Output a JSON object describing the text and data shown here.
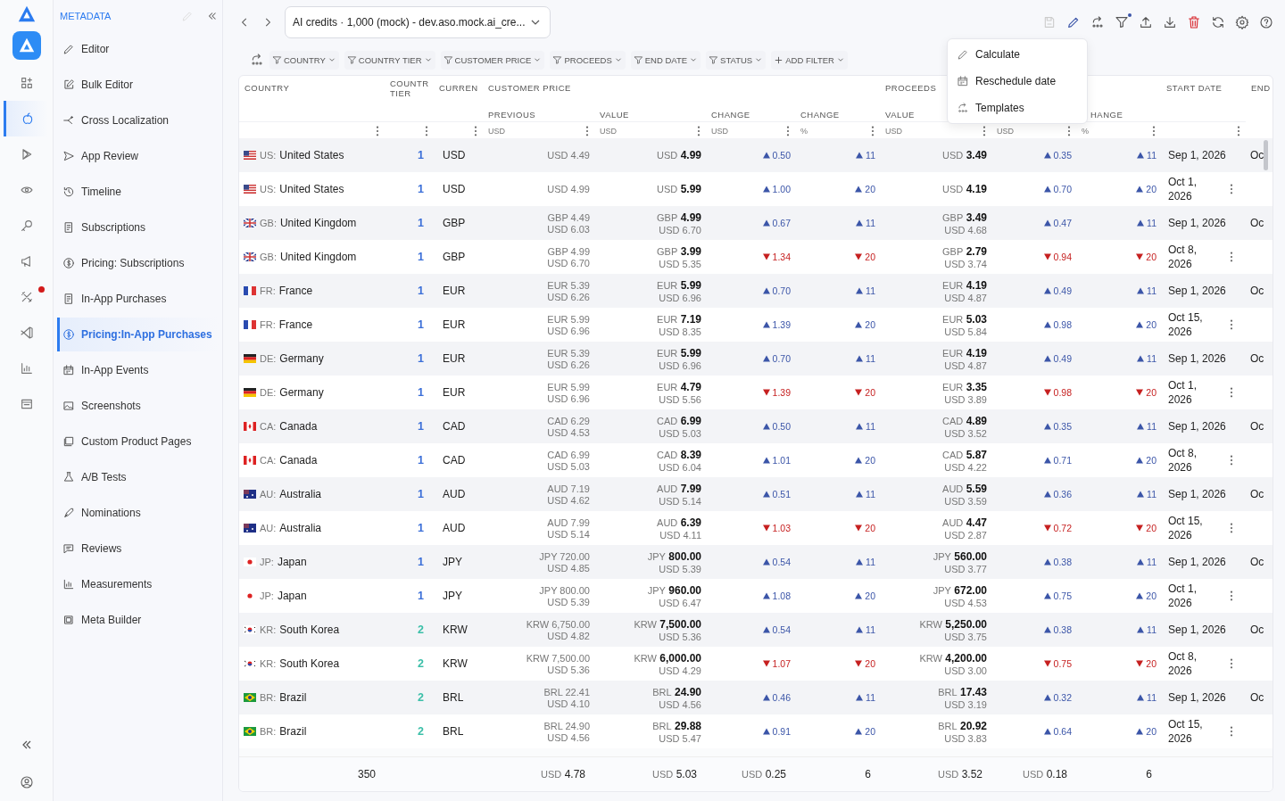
{
  "sidebar": {
    "title": "METADATA",
    "items": [
      {
        "label": "Editor",
        "selected": false
      },
      {
        "label": "Bulk Editor",
        "selected": false
      },
      {
        "label": "Cross Localization",
        "selected": false
      },
      {
        "label": "App Review",
        "selected": false
      },
      {
        "label": "Timeline",
        "selected": false
      },
      {
        "label": "Subscriptions",
        "selected": false
      },
      {
        "label": "Pricing: Subscriptions",
        "selected": false
      },
      {
        "label": "In-App Purchases",
        "selected": false
      },
      {
        "label": "Pricing:In-App Purchases",
        "selected": true
      },
      {
        "label": "In-App Events",
        "selected": false
      },
      {
        "label": "Screenshots",
        "selected": false
      },
      {
        "label": "Custom Product Pages",
        "selected": false
      },
      {
        "label": "A/B Tests",
        "selected": false
      },
      {
        "label": "Nominations",
        "selected": false
      },
      {
        "label": "Reviews",
        "selected": false
      },
      {
        "label": "Measurements",
        "selected": false
      },
      {
        "label": "Meta Builder",
        "selected": false
      }
    ]
  },
  "rail": [
    {
      "selected": false
    },
    {
      "selected": true
    },
    {
      "selected": false
    },
    {
      "selected": false
    },
    {
      "selected": false
    },
    {
      "selected": false
    },
    {
      "selected": false
    },
    {
      "selected": false
    },
    {
      "selected": false
    },
    {
      "selected": false
    }
  ],
  "product_select": {
    "value": "AI credits · 1,000 (mock) - dev.aso.mock.ai_cre..."
  },
  "filters": [
    "COUNTRY",
    "COUNTRY TIER",
    "CUSTOMER PRICE",
    "PROCEEDS",
    "END DATE",
    "STATUS"
  ],
  "add_filter": "ADD FILTER",
  "menu": [
    "Calculate",
    "Reschedule date",
    "Templates"
  ],
  "header": {
    "country": "COUNTRY",
    "tier": "COUNTR TIER",
    "currency": "CURREN",
    "customer_price": {
      "title": "CUSTOMER PRICE",
      "columns": [
        {
          "label": "PREVIOUS",
          "unit": "USD"
        },
        {
          "label": "VALUE",
          "unit": "USD"
        },
        {
          "label": "CHANGE",
          "unit": "USD"
        },
        {
          "label": "CHANGE",
          "unit": "%"
        }
      ]
    },
    "proceeds": {
      "title": "PROCEEDS",
      "columns": [
        {
          "label": "VALUE",
          "unit": "USD"
        },
        {
          "unit": "USD"
        },
        {
          "label": "HANGE",
          "unit": "%"
        }
      ]
    },
    "start_date": "START DATE",
    "end": "END"
  },
  "rows": [
    {
      "kind": "us",
      "code": "US:",
      "country": "United States",
      "tier": "1",
      "color": "#3b6fd8",
      "currency": "USD",
      "previous": {
        "local": "USD 4.49"
      },
      "value": {
        "currency": "USD",
        "amount": "4.99"
      },
      "increase": true,
      "change": "0.50",
      "change_pct": "11",
      "proceeds": {
        "currency": "USD",
        "amount": "3.49"
      },
      "proceeds_change": "0.35",
      "proceeds_change_pct": "11",
      "start_date": "Sep 1, 2026",
      "end_date": "Oc"
    },
    {
      "kind": "us",
      "code": "US:",
      "country": "United States",
      "tier": "1",
      "color": "#3b6fd8",
      "currency": "USD",
      "previous": {
        "local": "USD 4.99"
      },
      "value": {
        "currency": "USD",
        "amount": "5.99"
      },
      "increase": true,
      "change": "1.00",
      "change_pct": "20",
      "proceeds": {
        "currency": "USD",
        "amount": "4.19"
      },
      "proceeds_change": "0.70",
      "proceeds_change_pct": "20",
      "start_date": "Oct 1, 2026"
    },
    {
      "kind": "gb",
      "code": "GB:",
      "country": "United Kingdom",
      "tier": "1",
      "color": "#3b6fd8",
      "currency": "GBP",
      "previous": {
        "local": "GBP 4.49",
        "usd": "USD 6.03"
      },
      "value": {
        "currency": "GBP",
        "amount": "4.99",
        "usd": "USD 6.70"
      },
      "increase": true,
      "change": "0.67",
      "change_pct": "11",
      "proceeds": {
        "currency": "GBP",
        "amount": "3.49",
        "usd": "USD 4.68"
      },
      "proceeds_change": "0.47",
      "proceeds_change_pct": "11",
      "start_date": "Sep 1, 2026",
      "end_date": "Oc"
    },
    {
      "kind": "gb",
      "code": "GB:",
      "country": "United Kingdom",
      "tier": "1",
      "color": "#3b6fd8",
      "currency": "GBP",
      "previous": {
        "local": "GBP 4.99",
        "usd": "USD 6.70"
      },
      "value": {
        "currency": "GBP",
        "amount": "3.99",
        "usd": "USD 5.35"
      },
      "increase": false,
      "change": "1.34",
      "change_pct": "20",
      "proceeds": {
        "currency": "GBP",
        "amount": "2.79",
        "usd": "USD 3.74"
      },
      "proceeds_change": "0.94",
      "proceeds_change_pct": "20",
      "start_date": "Oct 8, 2026"
    },
    {
      "kind": "fr",
      "code": "FR:",
      "country": "France",
      "tier": "1",
      "color": "#3b6fd8",
      "currency": "EUR",
      "previous": {
        "local": "EUR 5.39",
        "usd": "USD 6.26"
      },
      "value": {
        "currency": "EUR",
        "amount": "5.99",
        "usd": "USD 6.96"
      },
      "increase": true,
      "change": "0.70",
      "change_pct": "11",
      "proceeds": {
        "currency": "EUR",
        "amount": "4.19",
        "usd": "USD 4.87"
      },
      "proceeds_change": "0.49",
      "proceeds_change_pct": "11",
      "start_date": "Sep 1, 2026",
      "end_date": "Oc"
    },
    {
      "kind": "fr",
      "code": "FR:",
      "country": "France",
      "tier": "1",
      "color": "#3b6fd8",
      "currency": "EUR",
      "previous": {
        "local": "EUR 5.99",
        "usd": "USD 6.96"
      },
      "value": {
        "currency": "EUR",
        "amount": "7.19",
        "usd": "USD 8.35"
      },
      "increase": true,
      "change": "1.39",
      "change_pct": "20",
      "proceeds": {
        "currency": "EUR",
        "amount": "5.03",
        "usd": "USD 5.84"
      },
      "proceeds_change": "0.98",
      "proceeds_change_pct": "20",
      "start_date": "Oct 15, 2026"
    },
    {
      "kind": "de",
      "code": "DE:",
      "country": "Germany",
      "tier": "1",
      "color": "#3b6fd8",
      "currency": "EUR",
      "previous": {
        "local": "EUR 5.39",
        "usd": "USD 6.26"
      },
      "value": {
        "currency": "EUR",
        "amount": "5.99",
        "usd": "USD 6.96"
      },
      "increase": true,
      "change": "0.70",
      "change_pct": "11",
      "proceeds": {
        "currency": "EUR",
        "amount": "4.19",
        "usd": "USD 4.87"
      },
      "proceeds_change": "0.49",
      "proceeds_change_pct": "11",
      "start_date": "Sep 1, 2026",
      "end_date": "Oc"
    },
    {
      "kind": "de",
      "code": "DE:",
      "country": "Germany",
      "tier": "1",
      "color": "#3b6fd8",
      "currency": "EUR",
      "previous": {
        "local": "EUR 5.99",
        "usd": "USD 6.96"
      },
      "value": {
        "currency": "EUR",
        "amount": "4.79",
        "usd": "USD 5.56"
      },
      "increase": false,
      "change": "1.39",
      "change_pct": "20",
      "proceeds": {
        "currency": "EUR",
        "amount": "3.35",
        "usd": "USD 3.89"
      },
      "proceeds_change": "0.98",
      "proceeds_change_pct": "20",
      "start_date": "Oct 1, 2026"
    },
    {
      "kind": "ca",
      "code": "CA:",
      "country": "Canada",
      "tier": "1",
      "color": "#3b6fd8",
      "currency": "CAD",
      "previous": {
        "local": "CAD 6.29",
        "usd": "USD 4.53"
      },
      "value": {
        "currency": "CAD",
        "amount": "6.99",
        "usd": "USD 5.03"
      },
      "increase": true,
      "change": "0.50",
      "change_pct": "11",
      "proceeds": {
        "currency": "CAD",
        "amount": "4.89",
        "usd": "USD 3.52"
      },
      "proceeds_change": "0.35",
      "proceeds_change_pct": "11",
      "start_date": "Sep 1, 2026",
      "end_date": "Oc"
    },
    {
      "kind": "ca",
      "code": "CA:",
      "country": "Canada",
      "tier": "1",
      "color": "#3b6fd8",
      "currency": "CAD",
      "previous": {
        "local": "CAD 6.99",
        "usd": "USD 5.03"
      },
      "value": {
        "currency": "CAD",
        "amount": "8.39",
        "usd": "USD 6.04"
      },
      "increase": true,
      "change": "1.01",
      "change_pct": "20",
      "proceeds": {
        "currency": "CAD",
        "amount": "5.87",
        "usd": "USD 4.22"
      },
      "proceeds_change": "0.71",
      "proceeds_change_pct": "20",
      "start_date": "Oct 8, 2026"
    },
    {
      "kind": "au",
      "code": "AU:",
      "country": "Australia",
      "tier": "1",
      "color": "#3b6fd8",
      "currency": "AUD",
      "previous": {
        "local": "AUD 7.19",
        "usd": "USD 4.62"
      },
      "value": {
        "currency": "AUD",
        "amount": "7.99",
        "usd": "USD 5.14"
      },
      "increase": true,
      "change": "0.51",
      "change_pct": "11",
      "proceeds": {
        "currency": "AUD",
        "amount": "5.59",
        "usd": "USD 3.59"
      },
      "proceeds_change": "0.36",
      "proceeds_change_pct": "11",
      "start_date": "Sep 1, 2026",
      "end_date": "Oc"
    },
    {
      "kind": "au",
      "code": "AU:",
      "country": "Australia",
      "tier": "1",
      "color": "#3b6fd8",
      "currency": "AUD",
      "previous": {
        "local": "AUD 7.99",
        "usd": "USD 5.14"
      },
      "value": {
        "currency": "AUD",
        "amount": "6.39",
        "usd": "USD 4.11"
      },
      "increase": false,
      "change": "1.03",
      "change_pct": "20",
      "proceeds": {
        "currency": "AUD",
        "amount": "4.47",
        "usd": "USD 2.87"
      },
      "proceeds_change": "0.72",
      "proceeds_change_pct": "20",
      "start_date": "Oct 15, 2026"
    },
    {
      "kind": "jp",
      "code": "JP:",
      "country": "Japan",
      "tier": "1",
      "color": "#3b6fd8",
      "currency": "JPY",
      "previous": {
        "local": "JPY 720.00",
        "usd": "USD 4.85"
      },
      "value": {
        "currency": "JPY",
        "amount": "800.00",
        "usd": "USD 5.39"
      },
      "increase": true,
      "change": "0.54",
      "change_pct": "11",
      "proceeds": {
        "currency": "JPY",
        "amount": "560.00",
        "usd": "USD 3.77"
      },
      "proceeds_change": "0.38",
      "proceeds_change_pct": "11",
      "start_date": "Sep 1, 2026",
      "end_date": "Oc"
    },
    {
      "kind": "jp",
      "code": "JP:",
      "country": "Japan",
      "tier": "1",
      "color": "#3b6fd8",
      "currency": "JPY",
      "previous": {
        "local": "JPY 800.00",
        "usd": "USD 5.39"
      },
      "value": {
        "currency": "JPY",
        "amount": "960.00",
        "usd": "USD 6.47"
      },
      "increase": true,
      "change": "1.08",
      "change_pct": "20",
      "proceeds": {
        "currency": "JPY",
        "amount": "672.00",
        "usd": "USD 4.53"
      },
      "proceeds_change": "0.75",
      "proceeds_change_pct": "20",
      "start_date": "Oct 1, 2026"
    },
    {
      "kind": "kr",
      "code": "KR:",
      "country": "South Korea",
      "tier": "2",
      "color": "#3bbfa8",
      "currency": "KRW",
      "previous": {
        "local": "KRW 6,750.00",
        "usd": "USD 4.82"
      },
      "value": {
        "currency": "KRW",
        "amount": "7,500.00",
        "usd": "USD 5.36"
      },
      "increase": true,
      "change": "0.54",
      "change_pct": "11",
      "proceeds": {
        "currency": "KRW",
        "amount": "5,250.00",
        "usd": "USD 3.75"
      },
      "proceeds_change": "0.38",
      "proceeds_change_pct": "11",
      "start_date": "Sep 1, 2026",
      "end_date": "Oc"
    },
    {
      "kind": "kr",
      "code": "KR:",
      "country": "South Korea",
      "tier": "2",
      "color": "#3bbfa8",
      "currency": "KRW",
      "previous": {
        "local": "KRW 7,500.00",
        "usd": "USD 5.36"
      },
      "value": {
        "currency": "KRW",
        "amount": "6,000.00",
        "usd": "USD 4.29"
      },
      "increase": false,
      "change": "1.07",
      "change_pct": "20",
      "proceeds": {
        "currency": "KRW",
        "amount": "4,200.00",
        "usd": "USD 3.00"
      },
      "proceeds_change": "0.75",
      "proceeds_change_pct": "20",
      "start_date": "Oct 8, 2026"
    },
    {
      "kind": "br",
      "code": "BR:",
      "country": "Brazil",
      "tier": "2",
      "color": "#3bbfa8",
      "currency": "BRL",
      "previous": {
        "local": "BRL 22.41",
        "usd": "USD 4.10"
      },
      "value": {
        "currency": "BRL",
        "amount": "24.90",
        "usd": "USD 4.56"
      },
      "increase": true,
      "change": "0.46",
      "change_pct": "11",
      "proceeds": {
        "currency": "BRL",
        "amount": "17.43",
        "usd": "USD 3.19"
      },
      "proceeds_change": "0.32",
      "proceeds_change_pct": "11",
      "start_date": "Sep 1, 2026",
      "end_date": "Oc"
    },
    {
      "kind": "br",
      "code": "BR:",
      "country": "Brazil",
      "tier": "2",
      "color": "#3bbfa8",
      "currency": "BRL",
      "previous": {
        "local": "BRL 24.90",
        "usd": "USD 4.56"
      },
      "value": {
        "currency": "BRL",
        "amount": "29.88",
        "usd": "USD 5.47"
      },
      "increase": true,
      "change": "0.91",
      "change_pct": "20",
      "proceeds": {
        "currency": "BRL",
        "amount": "20.92",
        "usd": "USD 3.83"
      },
      "proceeds_change": "0.64",
      "proceeds_change_pct": "20",
      "start_date": "Oct 15, 2026"
    }
  ],
  "totals": {
    "country": "350",
    "previous": {
      "currency": "USD",
      "amount": "4.78"
    },
    "value": {
      "currency": "USD",
      "amount": "5.03"
    },
    "change": {
      "currency": "USD",
      "amount": "0.25"
    },
    "change_pct": "6",
    "proceeds": {
      "currency": "USD",
      "amount": "3.52"
    },
    "proceeds_change": {
      "currency": "USD",
      "amount": "0.18"
    },
    "proceeds_change_pct": "6"
  }
}
